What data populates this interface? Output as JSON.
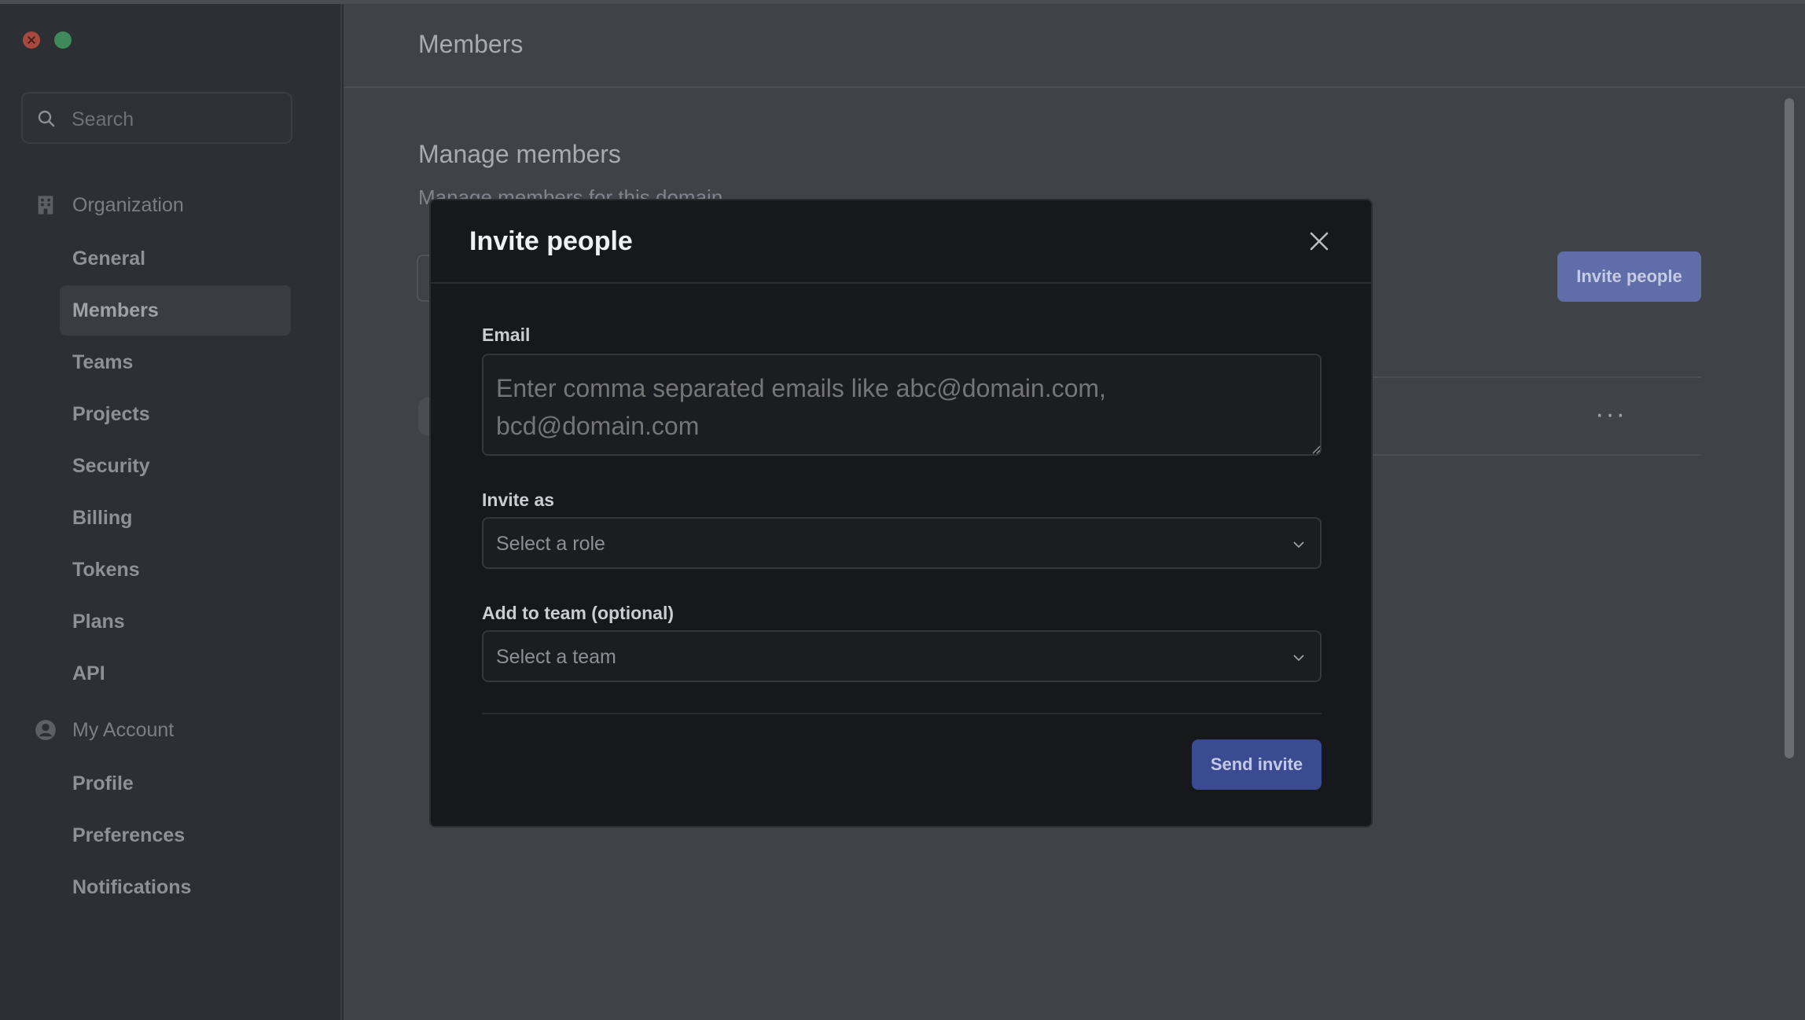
{
  "sidebar": {
    "search_placeholder": "Search",
    "organization": {
      "label": "Organization",
      "icon": "building-icon",
      "items": [
        "General",
        "Members",
        "Teams",
        "Projects",
        "Security",
        "Billing",
        "Tokens",
        "Plans",
        "API"
      ],
      "active": "Members"
    },
    "account": {
      "label": "My Account",
      "icon": "user-circle-icon",
      "items": [
        "Profile",
        "Preferences",
        "Notifications"
      ]
    }
  },
  "main": {
    "page_title": "Members",
    "section_title": "Manage members",
    "section_subtitle": "Manage members for this domain",
    "invite_button": "Invite people",
    "row_more": "···"
  },
  "modal": {
    "title": "Invite people",
    "email_label": "Email",
    "email_placeholder": "Enter comma separated emails like abc@domain.com, bcd@domain.com",
    "role_label": "Invite as",
    "role_placeholder": "Select a role",
    "team_label": "Add to team (optional)",
    "team_placeholder": "Select a team",
    "send_button": "Send invite"
  },
  "colors": {
    "modal_bg": "#17181b",
    "primary": "#3b4b91",
    "sidebar_bg": "#2c2f33"
  }
}
